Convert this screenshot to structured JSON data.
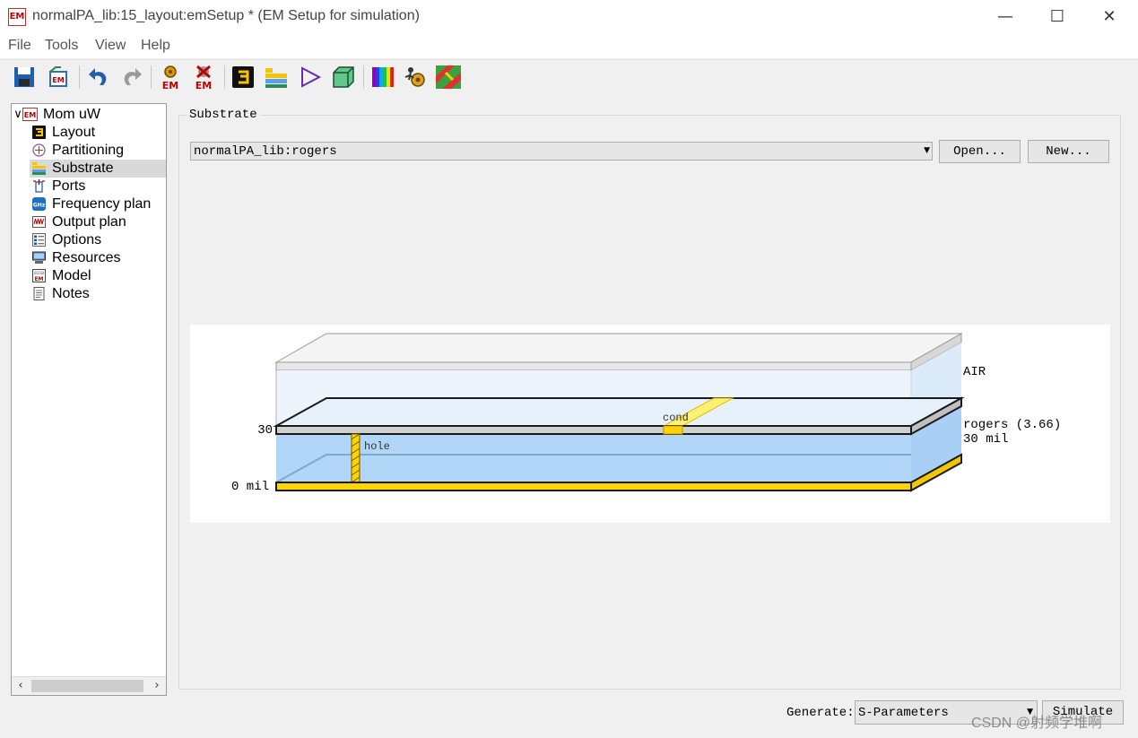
{
  "window": {
    "title": "normalPA_lib:15_layout:emSetup * (EM Setup for simulation)",
    "icon_text": "EM",
    "minimize_glyph": "—",
    "maximize_glyph": "☐",
    "close_glyph": "✕"
  },
  "menu": [
    "File",
    "Tools",
    "View",
    "Help"
  ],
  "toolbar": {
    "icons": [
      "save-icon",
      "em-setup-icon",
      "undo-icon",
      "redo-icon",
      "em-generate-icon",
      "em-cancel-icon",
      "layout-icon",
      "substrate-icon",
      "schematic-icon",
      "3d-view-icon",
      "color-spectrum-icon",
      "run-icon",
      "layout-view-icon"
    ],
    "em_text": "EM"
  },
  "tree": {
    "root_expander": "∨",
    "root_label": "Mom uW",
    "items": [
      {
        "label": "Layout",
        "icon": "layout-icon"
      },
      {
        "label": "Partitioning",
        "icon": "partitioning-icon"
      },
      {
        "label": "Substrate",
        "icon": "substrate-icon",
        "selected": true
      },
      {
        "label": "Ports",
        "icon": "ports-icon"
      },
      {
        "label": "Frequency plan",
        "icon": "frequency-icon"
      },
      {
        "label": "Output plan",
        "icon": "output-icon"
      },
      {
        "label": "Options",
        "icon": "options-icon"
      },
      {
        "label": "Resources",
        "icon": "resources-icon"
      },
      {
        "label": "Model",
        "icon": "model-icon"
      },
      {
        "label": "Notes",
        "icon": "notes-icon"
      }
    ],
    "scroll_left": "‹",
    "scroll_right": "›"
  },
  "substrate": {
    "group_label": "Substrate",
    "selected": "normalPA_lib:rogers",
    "dropdown_arrow": "▼",
    "open_button": "Open...",
    "new_button": "New..."
  },
  "diagram": {
    "air_label": "AIR",
    "material_label": "rogers (3.66)",
    "thickness_label": "30 mil",
    "top_label": "30",
    "bottom_label": "0 mil",
    "cond_label": "cond",
    "hole_label": "hole",
    "colors": {
      "air": "#eef4fb",
      "dielectric": "#b2d6f7",
      "metal": "#ffd400",
      "cover": "#d0d0d0"
    }
  },
  "bottom": {
    "generate_label": "Generate:",
    "generate_value": "S-Parameters",
    "dropdown_arrow": "▼",
    "simulate_button": "Simulate"
  },
  "watermark": "CSDN @射频学堆啊"
}
